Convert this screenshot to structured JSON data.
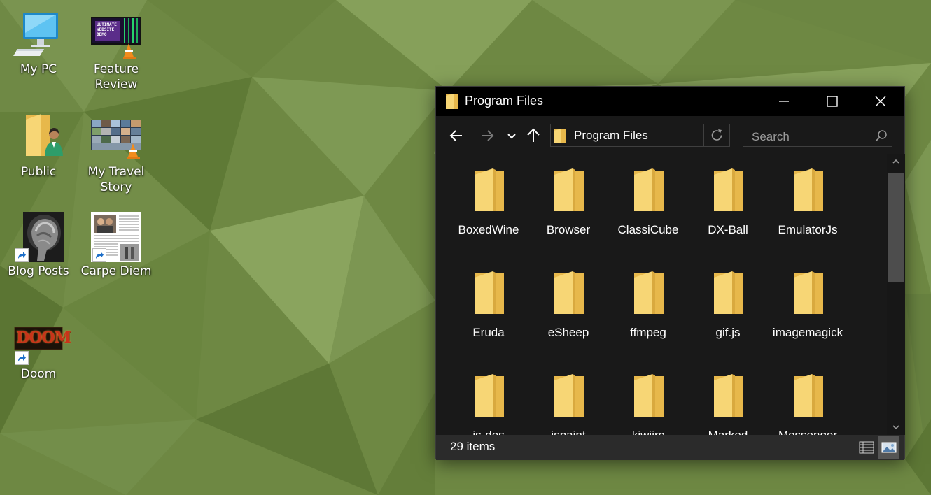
{
  "desktop": {
    "icons": [
      {
        "label": "My PC",
        "icon": "computer-icon"
      },
      {
        "label": "Feature Review",
        "icon": "video-icon",
        "thumb_text": "ULTIMATE WEBSITE DEMO"
      },
      {
        "label": "Public",
        "icon": "user-folder-icon"
      },
      {
        "label": "My Travel Story",
        "icon": "video-icon"
      },
      {
        "label": "Blog Posts",
        "icon": "shortcut-icon"
      },
      {
        "label": "Carpe Diem",
        "icon": "document-shortcut-icon"
      },
      {
        "label": "Doom",
        "icon": "game-shortcut-icon",
        "thumb_text": "DOOM"
      }
    ]
  },
  "explorer": {
    "title": "Program Files",
    "address": "Program Files",
    "search_placeholder": "Search",
    "status": "29 items",
    "items": [
      {
        "label": "BoxedWine"
      },
      {
        "label": "Browser"
      },
      {
        "label": "ClassiCube"
      },
      {
        "label": "DX-Ball"
      },
      {
        "label": "EmulatorJs"
      },
      {
        "label": "Eruda"
      },
      {
        "label": "eSheep"
      },
      {
        "label": "ffmpeg"
      },
      {
        "label": "gif.js"
      },
      {
        "label": "imagemagick"
      },
      {
        "label": "js-dos"
      },
      {
        "label": "jspaint"
      },
      {
        "label": "kiwiirc"
      },
      {
        "label": "Marked"
      },
      {
        "label": "Messenger"
      }
    ]
  },
  "colors": {
    "folder_yellow": "#f7d675",
    "folder_shade": "#e7b84b",
    "window_bg": "#191919",
    "titlebar_bg": "#000000",
    "statusbar_bg": "#2b2b2b",
    "desktop_green": "#6f8a44"
  }
}
